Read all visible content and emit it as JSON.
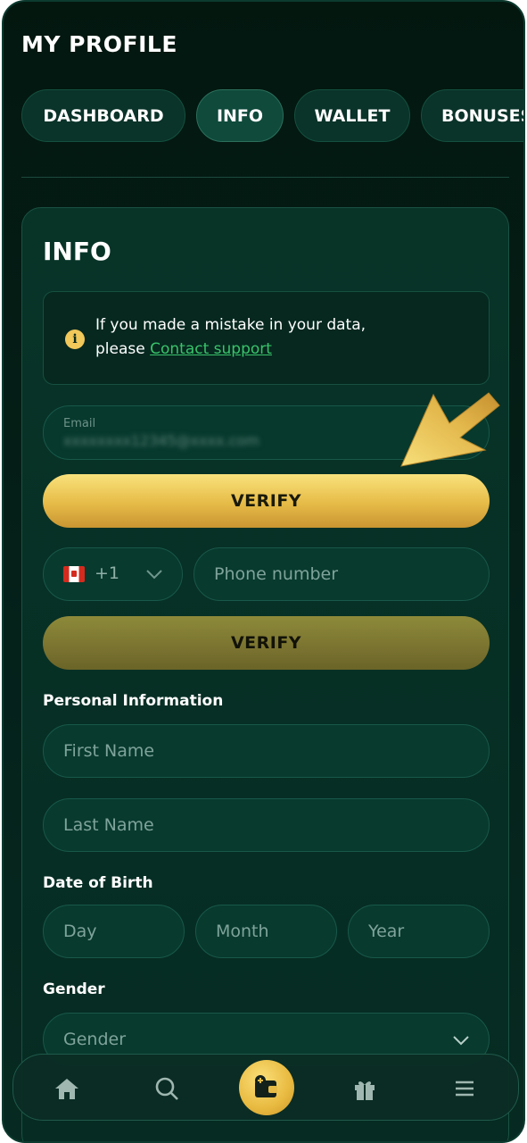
{
  "header": {
    "title": "MY PROFILE"
  },
  "tabs": [
    {
      "label": "DASHBOARD",
      "active": false
    },
    {
      "label": "INFO",
      "active": true
    },
    {
      "label": "WALLET",
      "active": false
    },
    {
      "label": "BONUSES",
      "active": false
    }
  ],
  "info": {
    "title": "INFO",
    "notice": {
      "line1": "If you made a mistake in your data,",
      "prefix": "please ",
      "link": "Contact support",
      "icon": "info-icon"
    },
    "email": {
      "label": "Email",
      "value": "blurred"
    },
    "verify_email_label": "VERIFY",
    "phone": {
      "country_code": "+1",
      "flag": "canada-flag-icon",
      "placeholder": "Phone number"
    },
    "verify_phone_label": "VERIFY",
    "personal_section": "Personal Information",
    "first_name_placeholder": "First Name",
    "last_name_placeholder": "Last Name",
    "dob_section": "Date of Birth",
    "dob": {
      "day": "Day",
      "month": "Month",
      "year": "Year"
    },
    "gender_section": "Gender",
    "gender_placeholder": "Gender"
  },
  "bottom_nav": [
    {
      "icon": "home-icon"
    },
    {
      "icon": "search-icon"
    },
    {
      "icon": "wallet-icon"
    },
    {
      "icon": "gift-icon"
    },
    {
      "icon": "menu-icon"
    }
  ],
  "colors": {
    "accent": "#e6bb47",
    "link": "#39c36a",
    "background": "#04211a"
  }
}
